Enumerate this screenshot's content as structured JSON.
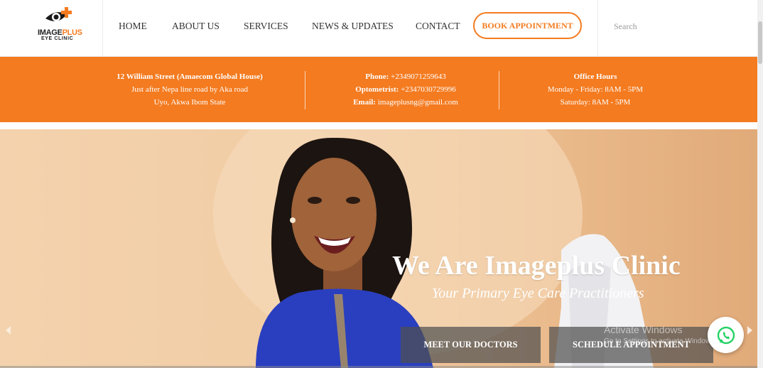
{
  "logo": {
    "line1_a": "IMAGE",
    "line1_b": "PLUS",
    "line2": "EYE CLINIC"
  },
  "nav": {
    "items": [
      "HOME",
      "ABOUT US",
      "SERVICES",
      "NEWS & UPDATES",
      "CONTACT"
    ],
    "book_label": "BOOK APPOINTMENT"
  },
  "search": {
    "placeholder": "Search"
  },
  "info": {
    "address": {
      "line1": "12 William Street (Amaecom Global House)",
      "line2": "Just after Nepa line road by Aka road",
      "line3": "Uyo, Akwa Ibom State"
    },
    "contact": {
      "phone_label": "Phone:",
      "phone": "+2349071259643",
      "optometrist_label": "Optometrist:",
      "optometrist": "+2347030729996",
      "email_label": "Email:",
      "email": "imageplusng@gmail.com"
    },
    "hours": {
      "title": "Office Hours",
      "line1": "Monday - Friday: 8AM - 5PM",
      "line2": "Saturday: 8AM - 5PM"
    }
  },
  "hero": {
    "title": "We Are Imageplus Clinic",
    "subtitle": "Your Primary Eye Care Practitioners",
    "btn_doctors": "MEET OUR DOCTORS",
    "btn_schedule": "SCHEDULE APPOINTMENT"
  },
  "watermark": {
    "line1": "Activate Windows",
    "line2": "Go to Settings to activate Windows."
  },
  "icons": {
    "logo": "eye-plus-logo-icon",
    "whatsapp": "whatsapp-icon",
    "prev": "chevron-left-icon",
    "next": "chevron-right-icon"
  },
  "colors": {
    "accent": "#f47b20",
    "whatsapp": "#25d366"
  }
}
